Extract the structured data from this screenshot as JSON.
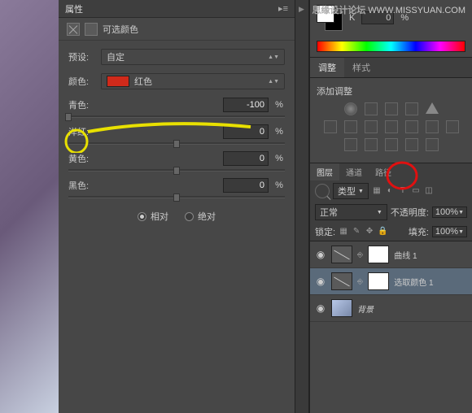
{
  "watermark": {
    "site": "思缘设计论坛",
    "url": "WWW.MISSYUAN.COM"
  },
  "properties": {
    "panel_title": "属性",
    "sub_title": "可选颜色",
    "preset_label": "预设:",
    "preset_value": "自定",
    "color_label": "颜色:",
    "color_value": "红色",
    "swatch_color": "#d02a1a",
    "sliders": {
      "cyan": {
        "label": "青色:",
        "value": "-100"
      },
      "magenta": {
        "label": "洋红:",
        "value": "0"
      },
      "yellow": {
        "label": "黄色:",
        "value": "0"
      },
      "black": {
        "label": "黑色:",
        "value": "0"
      }
    },
    "percent": "%",
    "radio_relative": "相对",
    "radio_absolute": "绝对"
  },
  "right_panel": {
    "k_label": "K",
    "k_value": "0",
    "k_pct": "%",
    "adjust_tab": "调整",
    "style_tab": "样式",
    "add_adjust": "添加调整",
    "layers_tab": "图层",
    "channels_tab": "通道",
    "paths_tab": "路径",
    "kind_label": "类型",
    "blend_mode": "正常",
    "opacity_label": "不透明度:",
    "opacity_value": "100%",
    "lock_label": "锁定:",
    "fill_label": "填充:",
    "fill_value": "100%",
    "layers": {
      "curves": "曲线 1",
      "selective": "选取颜色 1",
      "background": "背景"
    }
  }
}
